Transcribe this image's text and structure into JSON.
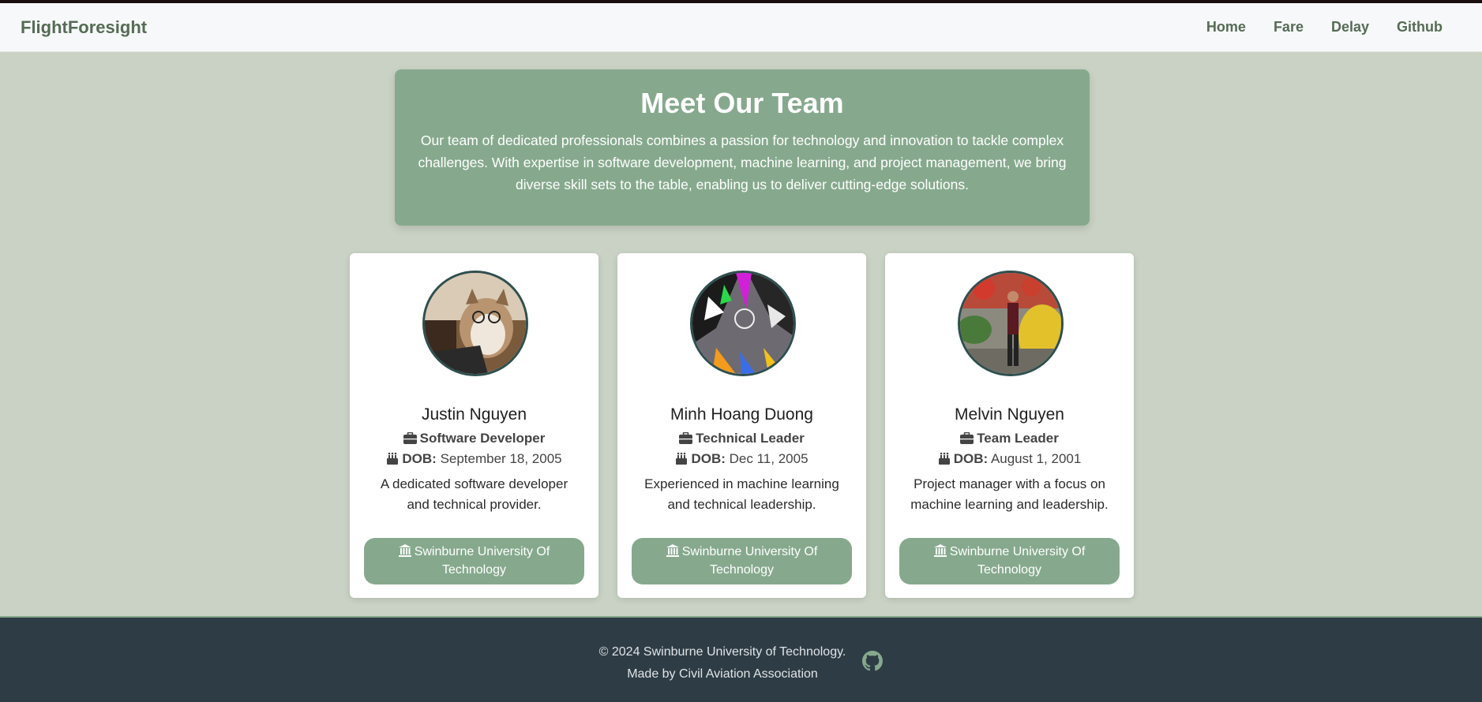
{
  "navbar": {
    "brand": "FlightForesight",
    "links": [
      "Home",
      "Fare",
      "Delay",
      "Github"
    ]
  },
  "hero": {
    "title": "Meet Our Team",
    "text": "Our team of dedicated professionals combines a passion for technology and innovation to tackle complex challenges. With expertise in software development, machine learning, and project management, we bring diverse skill sets to the table, enabling us to deliver cutting-edge solutions."
  },
  "team": [
    {
      "name": "Justin Nguyen",
      "role": "Software Developer",
      "dob_label": "DOB:",
      "dob": "September 18, 2005",
      "bio": "A dedicated software developer and technical provider.",
      "university": "Swinburne University Of Technology"
    },
    {
      "name": "Minh Hoang Duong",
      "role": "Technical Leader",
      "dob_label": "DOB:",
      "dob": "Dec 11, 2005",
      "bio": "Experienced in machine learning and technical leadership.",
      "university": "Swinburne University Of Technology"
    },
    {
      "name": "Melvin Nguyen",
      "role": "Team Leader",
      "dob_label": "DOB:",
      "dob": "August 1, 2001",
      "bio": "Project manager with a focus on machine learning and leadership.",
      "university": "Swinburne University Of Technology"
    }
  ],
  "footer": {
    "copyright": "© 2024 Swinburne University of Technology.",
    "made_by": "Made by Civil Aviation Association"
  },
  "icons": {
    "role": "briefcase-icon",
    "dob": "birthday-cake-icon",
    "university": "university-icon",
    "footer": "github-icon"
  },
  "colors": {
    "accent": "#86a98d",
    "page_background": "#c9d2c4",
    "footer_background": "#2e3c45",
    "nav_text": "#556b55"
  }
}
